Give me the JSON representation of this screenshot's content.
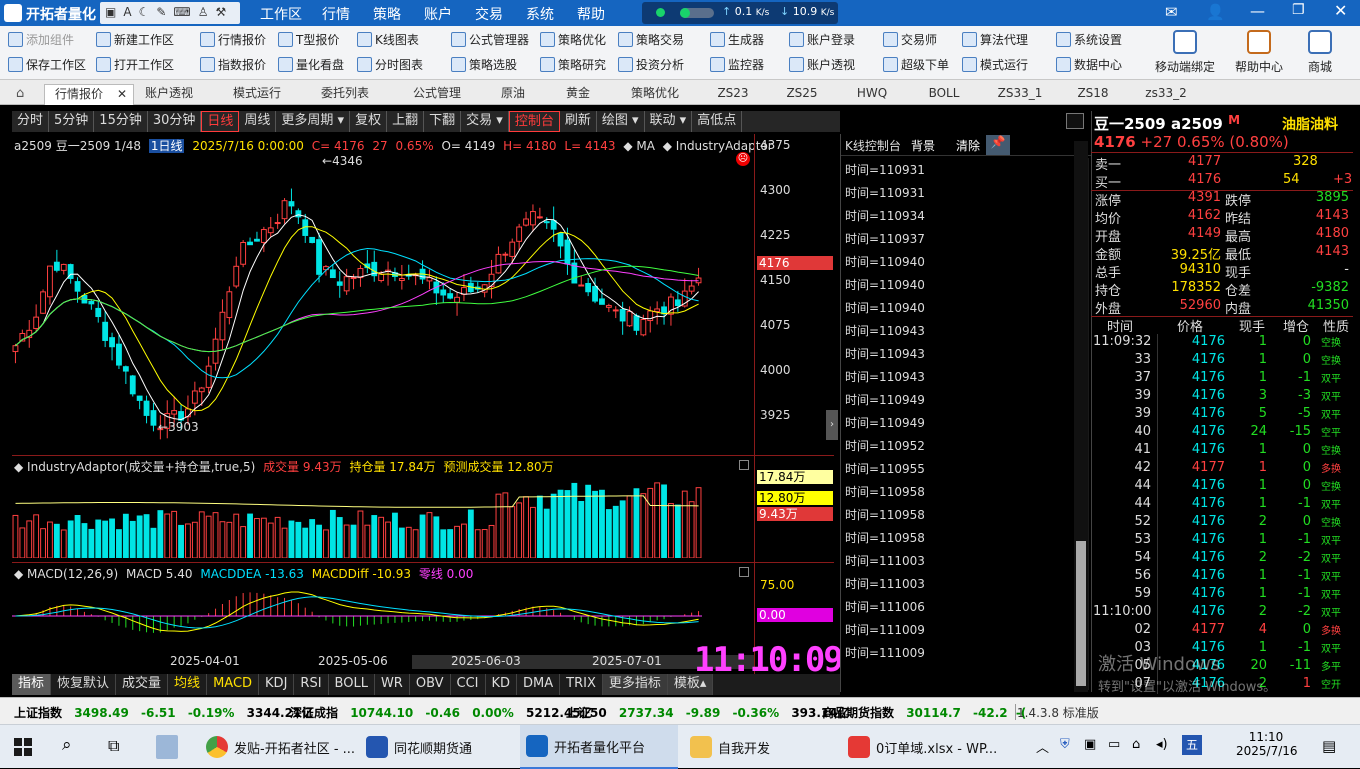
{
  "title": "开拓者量化",
  "menus": [
    "工作区",
    "行情",
    "策略",
    "账户",
    "交易",
    "系统",
    "帮助"
  ],
  "net": {
    "up": "0.1",
    "up_unit": "K/s",
    "down": "10.9",
    "down_unit": "K/s"
  },
  "toolbar": {
    "col1": [
      "添加组件",
      "保存工作区"
    ],
    "col2": [
      "新建工作区",
      "打开工作区"
    ],
    "col3": [
      "行情报价",
      "指数报价"
    ],
    "col4": [
      "T型报价",
      "量化看盘"
    ],
    "col5": [
      "K线图表",
      "分时图表"
    ],
    "col6": [
      "公式管理器",
      "策略选股"
    ],
    "col7": [
      "策略优化",
      "策略研究"
    ],
    "col8": [
      "策略交易",
      "投资分析"
    ],
    "col9": [
      "生成器",
      "监控器"
    ],
    "col10": [
      "账户登录",
      "账户透视"
    ],
    "col11": [
      "交易师",
      "超级下单"
    ],
    "col12": [
      "算法代理",
      "模式运行"
    ],
    "col13": [
      "系统设置",
      "数据中心"
    ],
    "big": [
      "移动端绑定",
      "帮助中心",
      "商城"
    ]
  },
  "tabs": [
    "行情报价",
    "账户透视",
    "模式运行",
    "委托列表",
    "公式管理",
    "原油",
    "黄金",
    "策略优化",
    "ZS23",
    "ZS25",
    "HWQ",
    "BOLL",
    "ZS33_1",
    "ZS18",
    "zs33_2"
  ],
  "periods": [
    "分时",
    "5分钟",
    "15分钟",
    "30分钟",
    "日线",
    "周线",
    "更多周期 ▾",
    "复权",
    "上翻",
    "下翻",
    "交易 ▾",
    "控制台",
    "刷新",
    "绘图 ▾",
    "联动 ▾",
    "高低点"
  ],
  "chart_info": {
    "code": "a2509 豆一2509 1/48",
    "period": "1日线",
    "date": "2025/7/16 0:00:00",
    "c": "C= 4176",
    "chg": "27",
    "pct": "0.65%",
    "o": "O= 4149",
    "h": "H= 4180",
    "l": "L= 4143",
    "ma": "◆ MA",
    "ind": "◆ IndustryAdaptor"
  },
  "price_axis": [
    "4375",
    "4300",
    "4225",
    "4150",
    "4075",
    "4000",
    "3925"
  ],
  "price_tag": "4176",
  "hi_label": "4346",
  "lo_label": "3903",
  "vol_info": {
    "name": "◆ IndustryAdaptor(成交量+持仓量,true,5)",
    "v1": "成交量 9.43万",
    "v2": "持仓量 17.84万",
    "v3": "预测成交量 12.80万"
  },
  "vol_tags": [
    "17.84万",
    "12.80万",
    "9.43万"
  ],
  "macd_info": {
    "name": "◆ MACD(12,26,9)",
    "macd": "MACD 5.40",
    "dea": "MACDDEA -13.63",
    "diff": "MACDDiff -10.93",
    "zero": "零线 0.00"
  },
  "macd_tags": [
    "75.00",
    "0.00"
  ],
  "dates": [
    "2025-04-01",
    "2025-05-06",
    "2025-06-03",
    "2025-07-01"
  ],
  "clock": "11:10:09",
  "bottom_tabs": [
    "指标",
    "恢复默认",
    "成交量",
    "均线",
    "MACD",
    "KDJ",
    "RSI",
    "BOLL",
    "WR",
    "OBV",
    "CCI",
    "KD",
    "DMA",
    "TRIX",
    "更多指标",
    "模板▴"
  ],
  "console": {
    "title": "K线控制台",
    "bg": "背景",
    "clear": "清除",
    "lines": [
      "时间=110931",
      "时间=110931",
      "时间=110934",
      "时间=110937",
      "时间=110940",
      "时间=110940",
      "时间=110940",
      "时间=110943",
      "时间=110943",
      "时间=110943",
      "时间=110949",
      "时间=110949",
      "时间=110952",
      "时间=110955",
      "时间=110958",
      "时间=110958",
      "时间=110958",
      "时间=111003",
      "时间=111003",
      "时间=111006",
      "时间=111009",
      "时间=111009"
    ]
  },
  "quote": {
    "name": "豆一2509 a2509",
    "flag": "M",
    "product": "油脂油料",
    "last": "4176",
    "chg": "+27",
    "pct": "0.65%",
    "pct2": "(0.80%)",
    "ask_label": "卖一",
    "ask": "4177",
    "ask_vol": "328",
    "bid_label": "买一",
    "bid": "4176",
    "bid_vol": "54",
    "bid_chg": "+3",
    "rows": [
      [
        "涨停",
        "4391",
        "跌停",
        "3895"
      ],
      [
        "均价",
        "4162",
        "昨结",
        "4143"
      ],
      [
        "开盘",
        "4149",
        "最高",
        "4180"
      ],
      [
        "金额",
        "39.25亿",
        "最低",
        "4143"
      ],
      [
        "总手",
        "94310",
        "现手",
        "-"
      ],
      [
        "持仓",
        "178352",
        "仓差",
        "-9382"
      ],
      [
        "外盘",
        "52960",
        "内盘",
        "41350"
      ]
    ],
    "tick_header": [
      "时间",
      "价格",
      "现手",
      "增仓",
      "性质"
    ],
    "ticks": [
      [
        "11:09:32",
        "4176",
        "1",
        "0",
        "空换"
      ],
      [
        "33",
        "4176",
        "1",
        "0",
        "空换"
      ],
      [
        "37",
        "4176",
        "1",
        "-1",
        "双平"
      ],
      [
        "39",
        "4176",
        "3",
        "-3",
        "双平"
      ],
      [
        "39",
        "4176",
        "5",
        "-5",
        "双平"
      ],
      [
        "40",
        "4176",
        "24",
        "-15",
        "空平"
      ],
      [
        "41",
        "4176",
        "1",
        "0",
        "空换"
      ],
      [
        "42",
        "4177",
        "1",
        "0",
        "多换"
      ],
      [
        "44",
        "4176",
        "1",
        "0",
        "空换"
      ],
      [
        "44",
        "4176",
        "1",
        "-1",
        "双平"
      ],
      [
        "52",
        "4176",
        "2",
        "0",
        "空换"
      ],
      [
        "53",
        "4176",
        "1",
        "-1",
        "双平"
      ],
      [
        "54",
        "4176",
        "2",
        "-2",
        "双平"
      ],
      [
        "56",
        "4176",
        "1",
        "-1",
        "双平"
      ],
      [
        "59",
        "4176",
        "1",
        "-1",
        "双平"
      ],
      [
        "11:10:00",
        "4176",
        "2",
        "-2",
        "双平"
      ],
      [
        "02",
        "4177",
        "4",
        "0",
        "多换"
      ],
      [
        "03",
        "4176",
        "1",
        "-1",
        "双平"
      ],
      [
        "05",
        "4176",
        "20",
        "-11",
        "多平"
      ],
      [
        "07",
        "4176",
        "2",
        "1",
        "空开"
      ]
    ]
  },
  "watermark": {
    "l1": "激活 Windows",
    "l2": "转到\"设置\"以激活 Windows。"
  },
  "status": {
    "i1": "上证指数",
    "i1v": "3498.49",
    "i1c": "-6.51",
    "i1p": "-0.19%",
    "i1a": "3344.21亿",
    "i2": "深证成指",
    "i2v": "10744.10",
    "i2c": "-0.46",
    "i2p": "0.00%",
    "i2a": "5212.45亿",
    "i3": "上证50",
    "i3v": "2737.34",
    "i3c": "-9.89",
    "i3p": "-0.36%",
    "i3a": "393.14亿",
    "i4": "商品期货指数",
    "i4v": "30114.7",
    "i4c": "-42.2",
    "i4x": "-(",
    "ver": "1.4.3.8 标准版"
  },
  "taskbar": {
    "apps": [
      "发贴-开拓者社区 - ...",
      "同花顺期货通",
      "开拓者量化平台",
      "自我开发",
      "0订单域.xlsx - WP..."
    ],
    "time": "11:10",
    "date": "2025/7/16",
    "ime": "五"
  }
}
